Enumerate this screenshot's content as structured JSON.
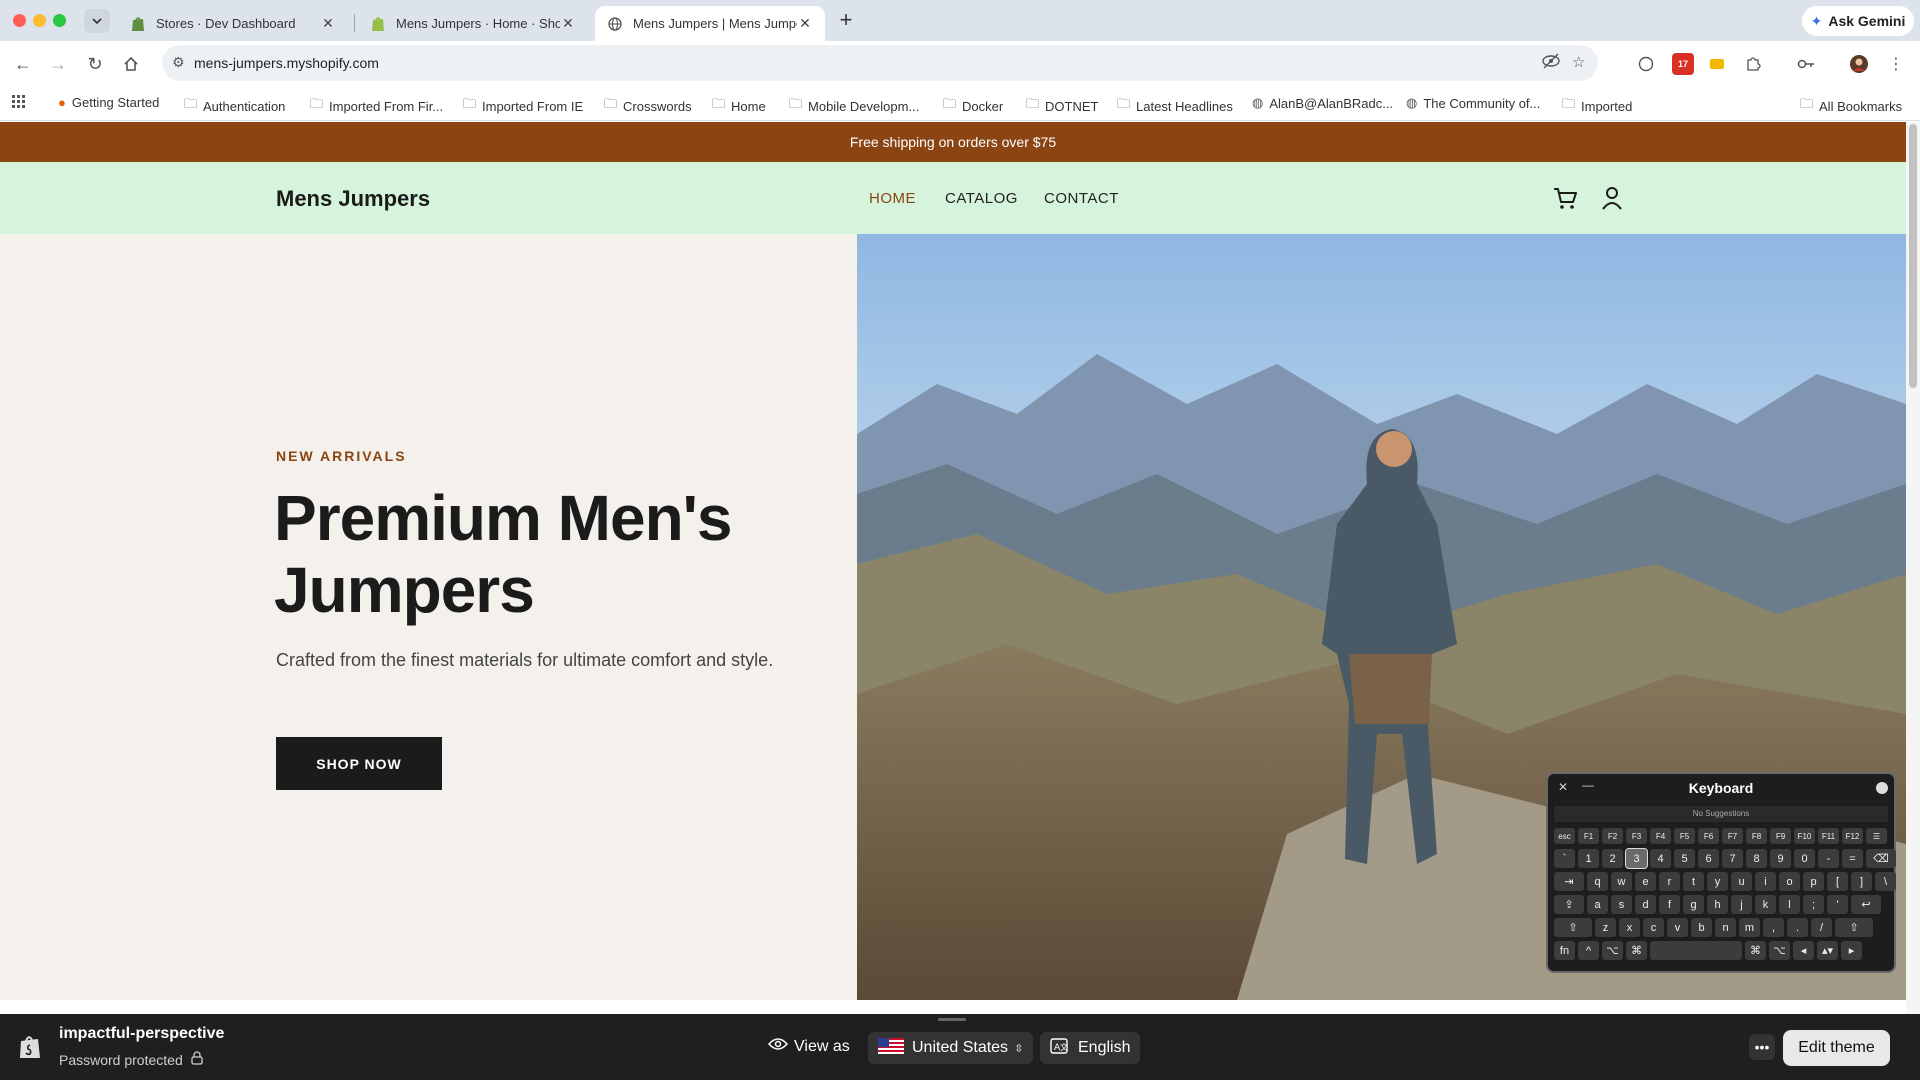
{
  "browser": {
    "tabs": [
      {
        "title": "Stores · Dev Dashboard",
        "active": false
      },
      {
        "title": "Mens Jumpers · Home · Shop",
        "active": false
      },
      {
        "title": "Mens Jumpers | Mens Jumpe",
        "active": true
      }
    ],
    "gemini_label": "Ask Gemini",
    "url": "mens-jumpers.myshopify.com",
    "extension_badge": "17",
    "bookmarks": [
      "Getting Started",
      "Authentication",
      "Imported From Fir...",
      "Imported From IE",
      "Crosswords",
      "Home",
      "Mobile Developm...",
      "Docker",
      "DOTNET",
      "Latest Headlines",
      "AlanB@AlanBRadc...",
      "The Community of...",
      "Imported"
    ],
    "all_bookmarks": "All Bookmarks"
  },
  "store": {
    "announcement": "Free shipping on orders over $75",
    "logo": "Mens Jumpers",
    "nav": [
      "HOME",
      "CATALOG",
      "CONTACT"
    ],
    "hero": {
      "eyebrow": "NEW ARRIVALS",
      "title": "Premium Men's Jumpers",
      "subtitle": "Crafted from the finest materials for ultimate comfort and style.",
      "cta": "SHOP NOW"
    }
  },
  "keyboard": {
    "title": "Keyboard",
    "suggestions": "No Suggestions",
    "rows": [
      [
        "esc",
        "F1",
        "F2",
        "F3",
        "F4",
        "F5",
        "F6",
        "F7",
        "F8",
        "F9",
        "F10",
        "F11",
        "F12",
        "☰"
      ],
      [
        "`",
        "1",
        "2",
        "3",
        "4",
        "5",
        "6",
        "7",
        "8",
        "9",
        "0",
        "-",
        "=",
        "⌫"
      ],
      [
        "⇥",
        "q",
        "w",
        "e",
        "r",
        "t",
        "y",
        "u",
        "i",
        "o",
        "p",
        "[",
        "]",
        "\\"
      ],
      [
        "⇪",
        "a",
        "s",
        "d",
        "f",
        "g",
        "h",
        "j",
        "k",
        "l",
        ";",
        "'",
        "↩"
      ],
      [
        "⇧",
        "z",
        "x",
        "c",
        "v",
        "b",
        "n",
        "m",
        ",",
        ".",
        "/",
        "⇧"
      ],
      [
        "fn",
        "^",
        "⌥",
        "⌘",
        " ",
        "⌘",
        "⌥",
        "◂",
        "▴▾",
        "▸"
      ]
    ]
  },
  "shopify_bar": {
    "store_name": "impactful-perspective",
    "status": "Password protected",
    "view_as": "View as",
    "country": "United States",
    "language": "English",
    "edit_theme": "Edit theme"
  }
}
